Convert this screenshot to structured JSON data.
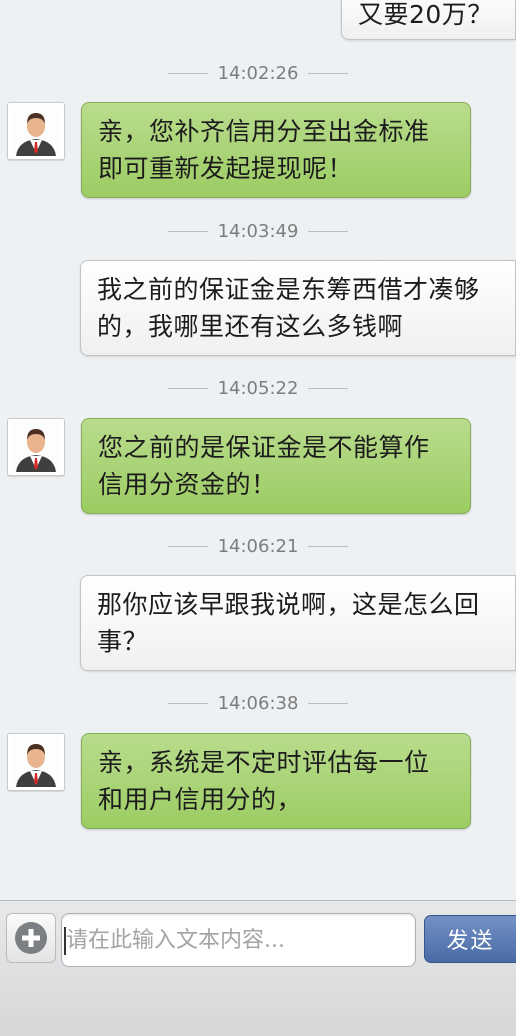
{
  "messages": [
    {
      "from": "me",
      "text": "又要20万？"
    },
    {
      "time": "14:02:26",
      "from": "agent",
      "text": "亲，您补齐信用分至出金标准即可重新发起提现呢！"
    },
    {
      "time": "14:03:49",
      "from": "me",
      "text": "我之前的保证金是东筹西借才凑够的，我哪里还有这么多钱啊"
    },
    {
      "time": "14:05:22",
      "from": "agent",
      "text": "您之前的是保证金是不能算作信用分资金的！"
    },
    {
      "time": "14:06:21",
      "from": "me",
      "text": "那你应该早跟我说啊，这是怎么回事？"
    },
    {
      "time": "14:06:38",
      "from": "agent",
      "text": "亲，系统是不定时评估每一位和用户信用分的，"
    }
  ],
  "input": {
    "placeholder": "请在此输入文本内容...",
    "value": ""
  },
  "buttons": {
    "send_label": "发送",
    "plus_icon": "plus-circle-icon"
  },
  "colors": {
    "agent_bubble": "#a8d274",
    "my_bubble": "#f6f6f6",
    "send_button": "#5676b0",
    "background": "#eef1f4"
  }
}
